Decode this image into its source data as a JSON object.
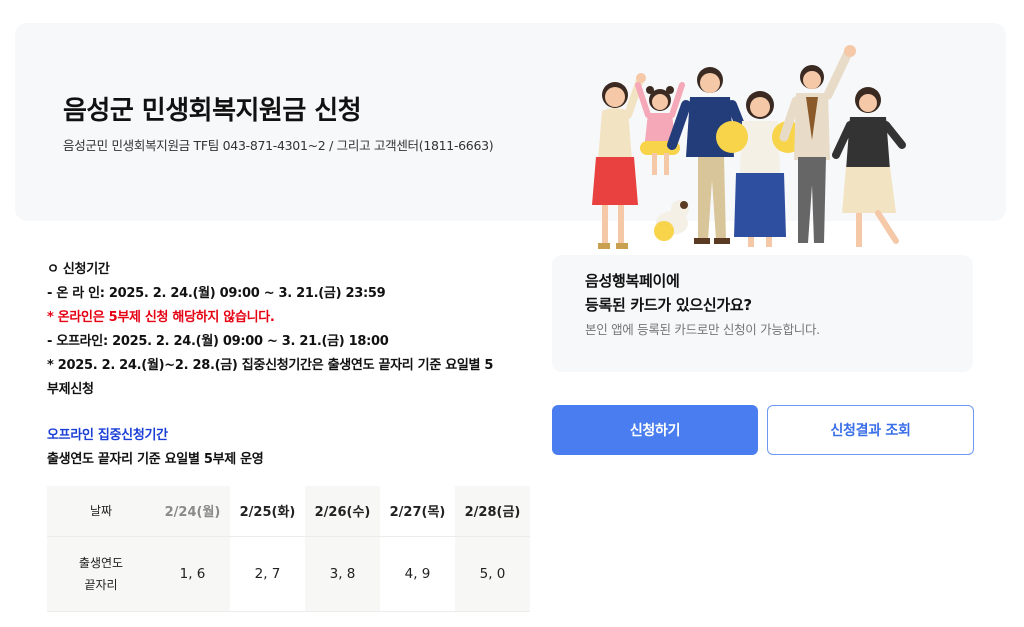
{
  "hero": {
    "title": "음성군 민생회복지원금 신청",
    "subtitle": "음성군민 민생회복지원금 TF팀 043-871-4301~2 / 그리고 고객센터(1811-6663)"
  },
  "info": {
    "period_heading": "ㅇ 신청기간",
    "online": "- 온 라 인: 2025. 2. 24.(월) 09:00 ~ 3. 21.(금) 23:59",
    "online_note": "* 온라인은 5부제 신청 해당하지 않습니다.",
    "offline": "- 오프라인: 2025. 2. 24.(월) 09:00 ~ 3. 21.(금) 18:00",
    "focus_note_1": "* 2025. 2. 24.(월)~2. 28.(금) 집중신청기간은 출생연도 끝자리 기준 요일별 5",
    "focus_note_2": "부제신청",
    "offline_focus_heading": "오프라인 집중신청기간",
    "offline_focus_desc": "출생연도 끝자리 기준 요일별 5부제 운영"
  },
  "schedule": {
    "date_label": "날짜",
    "digit_label_1": "출생연도",
    "digit_label_2": "끝자리",
    "days": [
      {
        "date": "2/24(월)",
        "digits": "1, 6"
      },
      {
        "date": "2/25(화)",
        "digits": "2, 7"
      },
      {
        "date": "2/26(수)",
        "digits": "3, 8"
      },
      {
        "date": "2/27(목)",
        "digits": "4, 9"
      },
      {
        "date": "2/28(금)",
        "digits": "5, 0"
      }
    ]
  },
  "card": {
    "title_line1": "음성행복페이에",
    "title_line2": "등록된 카드가 있으신가요?",
    "description": "본인 앱에 등록된 카드로만 신청이 가능합니다."
  },
  "buttons": {
    "apply": "신청하기",
    "result": "신청결과 조회"
  },
  "colors": {
    "primary": "#4a7df0",
    "notice_red": "#e60012",
    "heading_blue": "#1a3fd6"
  },
  "illustration": "family-celebrating-illustration"
}
